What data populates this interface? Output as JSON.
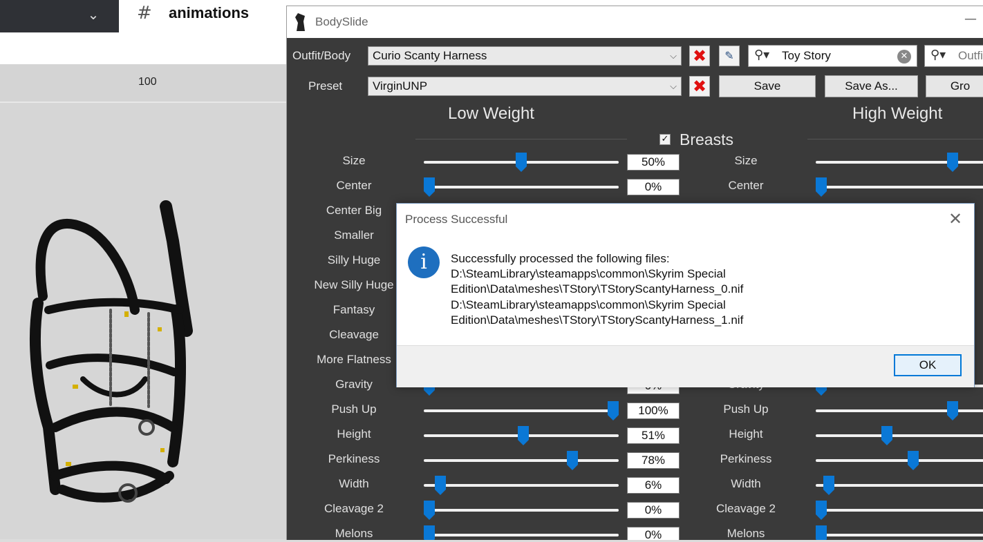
{
  "background_app": {
    "channel_name": "animations",
    "channel_icon": "hash-lock-icon",
    "zoom_value": "100"
  },
  "bodyslide": {
    "window_title": "BodySlide",
    "outfit_label": "Outfit/Body",
    "outfit_value": "Curio Scanty Harness",
    "preset_label": "Preset",
    "preset_value": "VirginUNP",
    "save_label": "Save",
    "save_as_label": "Save As...",
    "group_button_partial": "Gro",
    "filter1_value": "Toy Story",
    "filter2_partial": "Outfi",
    "low_weight": "Low Weight",
    "high_weight": "High Weight",
    "category": "Breasts",
    "accent_color": "#0a78d6",
    "sliders": [
      {
        "label": "Size",
        "low": "50%",
        "low_frac": 0.5,
        "high_frac": 1.0
      },
      {
        "label": "Center",
        "low": "0%",
        "low_frac": 0.0,
        "high_frac": 0.0
      },
      {
        "label": "Center Big"
      },
      {
        "label": "Smaller"
      },
      {
        "label": "Silly Huge"
      },
      {
        "label": "New Silly Huge"
      },
      {
        "label": "Fantasy"
      },
      {
        "label": "Cleavage"
      },
      {
        "label": "More Flatness"
      },
      {
        "label": "Gravity",
        "low": "0%",
        "low_frac": 0.0,
        "high_frac": 0.0
      },
      {
        "label": "Push Up",
        "low": "100%",
        "low_frac": 1.0,
        "high_frac": 1.0
      },
      {
        "label": "Height",
        "low": "51%",
        "low_frac": 0.51,
        "high_frac": 0.5
      },
      {
        "label": "Perkiness",
        "low": "78%",
        "low_frac": 0.78,
        "high_frac": 0.7
      },
      {
        "label": "Width",
        "low": "6%",
        "low_frac": 0.06,
        "high_frac": 0.06
      },
      {
        "label": "Cleavage 2",
        "low": "0%",
        "low_frac": 0.0,
        "high_frac": 0.0
      },
      {
        "label": "Melons",
        "low": "0%",
        "low_frac": 0.0,
        "high_frac": 0.0
      }
    ]
  },
  "dialog": {
    "title": "Process Successful",
    "lines": [
      "Successfully processed the following files:",
      "D:\\SteamLibrary\\steamapps\\common\\Skyrim Special",
      "Edition\\Data\\meshes\\TStory\\TStoryScantyHarness_0.nif",
      "D:\\SteamLibrary\\steamapps\\common\\Skyrim Special",
      "Edition\\Data\\meshes\\TStory\\TStoryScantyHarness_1.nif"
    ],
    "ok_label": "OK"
  }
}
